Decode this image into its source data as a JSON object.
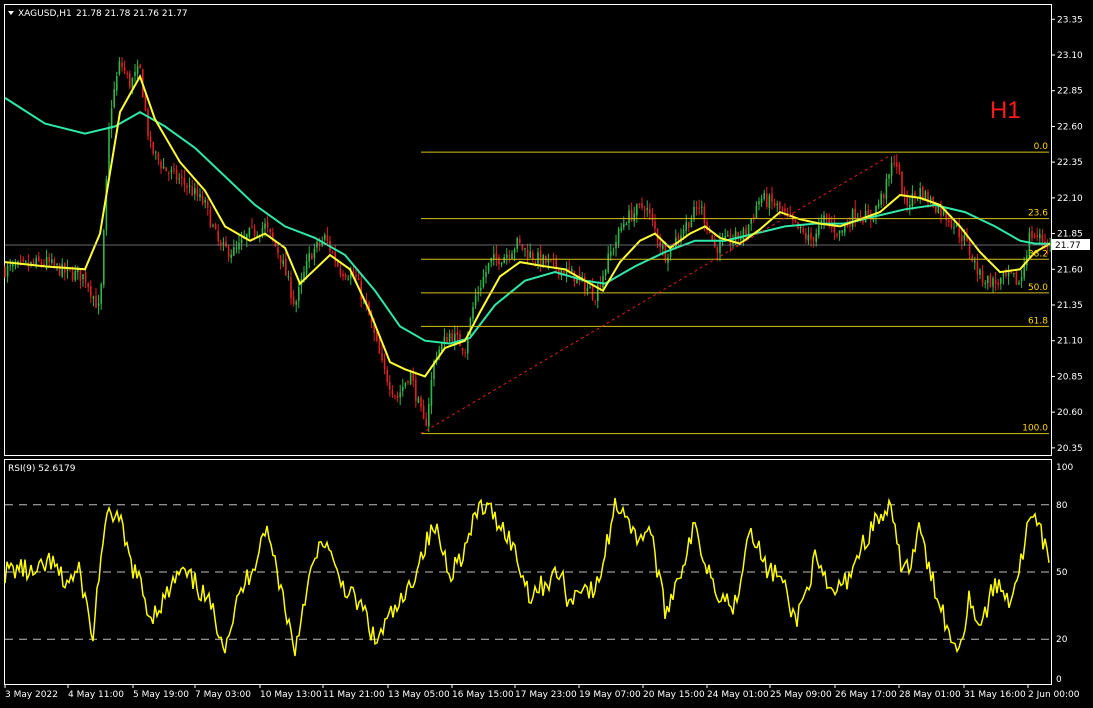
{
  "header": {
    "symbol_label": "XAGUSD,H1",
    "ohlc": "21.78 21.78 21.76 21.77",
    "timeframe_badge": "H1"
  },
  "rsi_panel": {
    "label": "RSI(9) 52.6179",
    "levels": [
      80,
      50,
      20
    ],
    "axis_top": "100",
    "axis_bottom": "0"
  },
  "colors": {
    "background": "#000000",
    "bull_candle": "#2fb84a",
    "bear_candle": "#e02020",
    "ma_fast": "#ffff33",
    "ma_slow": "#2ee8a8",
    "fib": "#d4c21a",
    "trendline": "#d92020",
    "rsi": "#ffff00",
    "axis_text": "#ffffff"
  },
  "chart_data": {
    "type": "candlestick",
    "symbol": "XAGUSD",
    "timeframe": "H1",
    "current_price": "21.77",
    "price_axis_ticks": [
      "23.35",
      "23.10",
      "22.85",
      "22.60",
      "22.35",
      "22.10",
      "21.85",
      "21.60",
      "21.35",
      "21.10",
      "20.85",
      "20.60",
      "20.35"
    ],
    "ylim": [
      20.3,
      23.45
    ],
    "time_axis_labels": [
      "3 May 2022",
      "4 May 11:00",
      "5 May 19:00",
      "7 May 03:00",
      "10 May 13:00",
      "11 May 21:00",
      "13 May 05:00",
      "16 May 15:00",
      "17 May 23:00",
      "19 May 07:00",
      "20 May 15:00",
      "24 May 01:00",
      "25 May 09:00",
      "26 May 17:00",
      "28 May 01:00",
      "31 May 16:00",
      "2 Jun 00:00"
    ],
    "close_path": [
      [
        0,
        21.6
      ],
      [
        20,
        21.62
      ],
      [
        40,
        21.65
      ],
      [
        60,
        21.58
      ],
      [
        80,
        21.55
      ],
      [
        95,
        21.3
      ],
      [
        105,
        22.7
      ],
      [
        115,
        23.05
      ],
      [
        125,
        22.9
      ],
      [
        135,
        23.0
      ],
      [
        145,
        22.45
      ],
      [
        160,
        22.3
      ],
      [
        180,
        22.2
      ],
      [
        200,
        22.05
      ],
      [
        215,
        21.75
      ],
      [
        230,
        21.72
      ],
      [
        245,
        21.85
      ],
      [
        260,
        21.9
      ],
      [
        275,
        21.7
      ],
      [
        290,
        21.35
      ],
      [
        305,
        21.7
      ],
      [
        320,
        21.82
      ],
      [
        335,
        21.6
      ],
      [
        350,
        21.55
      ],
      [
        365,
        21.25
      ],
      [
        378,
        20.9
      ],
      [
        392,
        20.7
      ],
      [
        405,
        20.88
      ],
      [
        420,
        20.48
      ],
      [
        430,
        21.0
      ],
      [
        445,
        21.15
      ],
      [
        460,
        21.05
      ],
      [
        470,
        21.4
      ],
      [
        485,
        21.65
      ],
      [
        500,
        21.7
      ],
      [
        512,
        21.78
      ],
      [
        530,
        21.68
      ],
      [
        550,
        21.62
      ],
      [
        570,
        21.55
      ],
      [
        590,
        21.42
      ],
      [
        605,
        21.7
      ],
      [
        620,
        21.95
      ],
      [
        640,
        22.05
      ],
      [
        660,
        21.7
      ],
      [
        680,
        21.9
      ],
      [
        695,
        22.05
      ],
      [
        710,
        21.75
      ],
      [
        725,
        21.8
      ],
      [
        740,
        21.85
      ],
      [
        755,
        22.1
      ],
      [
        770,
        22.05
      ],
      [
        790,
        21.9
      ],
      [
        805,
        21.8
      ],
      [
        820,
        21.95
      ],
      [
        835,
        21.85
      ],
      [
        850,
        22.0
      ],
      [
        865,
        21.95
      ],
      [
        880,
        22.15
      ],
      [
        890,
        22.4
      ],
      [
        900,
        22.05
      ],
      [
        915,
        22.15
      ],
      [
        930,
        22.05
      ],
      [
        945,
        21.95
      ],
      [
        960,
        21.8
      ],
      [
        975,
        21.55
      ],
      [
        990,
        21.5
      ],
      [
        1005,
        21.55
      ],
      [
        1015,
        21.5
      ],
      [
        1025,
        21.85
      ],
      [
        1040,
        21.8
      ],
      [
        1045,
        21.77
      ]
    ],
    "ma_fast_path": [
      [
        0,
        21.65
      ],
      [
        40,
        21.62
      ],
      [
        80,
        21.6
      ],
      [
        95,
        21.85
      ],
      [
        115,
        22.7
      ],
      [
        135,
        22.95
      ],
      [
        150,
        22.65
      ],
      [
        175,
        22.35
      ],
      [
        200,
        22.15
      ],
      [
        220,
        21.9
      ],
      [
        245,
        21.8
      ],
      [
        260,
        21.85
      ],
      [
        280,
        21.75
      ],
      [
        295,
        21.5
      ],
      [
        310,
        21.6
      ],
      [
        325,
        21.7
      ],
      [
        345,
        21.6
      ],
      [
        365,
        21.3
      ],
      [
        385,
        20.95
      ],
      [
        400,
        20.9
      ],
      [
        420,
        20.85
      ],
      [
        440,
        21.05
      ],
      [
        460,
        21.1
      ],
      [
        475,
        21.3
      ],
      [
        495,
        21.55
      ],
      [
        515,
        21.65
      ],
      [
        540,
        21.62
      ],
      [
        560,
        21.6
      ],
      [
        580,
        21.52
      ],
      [
        598,
        21.45
      ],
      [
        615,
        21.65
      ],
      [
        635,
        21.8
      ],
      [
        650,
        21.85
      ],
      [
        665,
        21.75
      ],
      [
        685,
        21.85
      ],
      [
        700,
        21.9
      ],
      [
        715,
        21.82
      ],
      [
        735,
        21.78
      ],
      [
        755,
        21.88
      ],
      [
        775,
        22.0
      ],
      [
        795,
        21.95
      ],
      [
        815,
        21.92
      ],
      [
        835,
        21.9
      ],
      [
        855,
        21.95
      ],
      [
        875,
        22.0
      ],
      [
        895,
        22.12
      ],
      [
        915,
        22.1
      ],
      [
        935,
        22.05
      ],
      [
        955,
        21.9
      ],
      [
        975,
        21.72
      ],
      [
        995,
        21.58
      ],
      [
        1015,
        21.6
      ],
      [
        1030,
        21.72
      ],
      [
        1045,
        21.78
      ]
    ],
    "ma_slow_path": [
      [
        0,
        22.8
      ],
      [
        40,
        22.62
      ],
      [
        80,
        22.55
      ],
      [
        110,
        22.6
      ],
      [
        135,
        22.7
      ],
      [
        160,
        22.6
      ],
      [
        190,
        22.45
      ],
      [
        220,
        22.25
      ],
      [
        250,
        22.05
      ],
      [
        280,
        21.9
      ],
      [
        310,
        21.82
      ],
      [
        340,
        21.7
      ],
      [
        370,
        21.45
      ],
      [
        395,
        21.2
      ],
      [
        420,
        21.1
      ],
      [
        445,
        21.08
      ],
      [
        465,
        21.12
      ],
      [
        490,
        21.35
      ],
      [
        520,
        21.52
      ],
      [
        550,
        21.58
      ],
      [
        580,
        21.52
      ],
      [
        600,
        21.5
      ],
      [
        630,
        21.62
      ],
      [
        660,
        21.72
      ],
      [
        690,
        21.8
      ],
      [
        720,
        21.8
      ],
      [
        750,
        21.85
      ],
      [
        780,
        21.9
      ],
      [
        810,
        21.92
      ],
      [
        840,
        21.92
      ],
      [
        870,
        21.97
      ],
      [
        900,
        22.02
      ],
      [
        930,
        22.05
      ],
      [
        960,
        22.0
      ],
      [
        990,
        21.9
      ],
      [
        1015,
        21.8
      ],
      [
        1030,
        21.78
      ],
      [
        1045,
        21.78
      ]
    ],
    "fibonacci": {
      "high": 22.42,
      "low": 20.45,
      "levels": [
        {
          "label": "0.0",
          "price": 22.42
        },
        {
          "label": "23.6",
          "price": 21.955
        },
        {
          "label": "38.2",
          "price": 21.67
        },
        {
          "label": "50.0",
          "price": 21.435
        },
        {
          "label": "61.8",
          "price": 21.2
        },
        {
          "label": "100.0",
          "price": 20.45
        }
      ]
    },
    "trendline": {
      "from_price": 20.45,
      "to_price": 22.4
    },
    "rsi": {
      "period": 9,
      "ylim": [
        0,
        100
      ],
      "levels": [
        80,
        50,
        20
      ],
      "path": [
        [
          0,
          50
        ],
        [
          15,
          52
        ],
        [
          30,
          48
        ],
        [
          45,
          55
        ],
        [
          60,
          45
        ],
        [
          75,
          50
        ],
        [
          88,
          20
        ],
        [
          95,
          55
        ],
        [
          105,
          78
        ],
        [
          115,
          72
        ],
        [
          125,
          55
        ],
        [
          135,
          45
        ],
        [
          145,
          30
        ],
        [
          160,
          38
        ],
        [
          175,
          50
        ],
        [
          190,
          45
        ],
        [
          205,
          35
        ],
        [
          220,
          18
        ],
        [
          235,
          40
        ],
        [
          250,
          55
        ],
        [
          260,
          70
        ],
        [
          270,
          55
        ],
        [
          280,
          35
        ],
        [
          290,
          15
        ],
        [
          300,
          40
        ],
        [
          310,
          55
        ],
        [
          320,
          65
        ],
        [
          330,
          50
        ],
        [
          345,
          40
        ],
        [
          360,
          32
        ],
        [
          370,
          18
        ],
        [
          385,
          30
        ],
        [
          400,
          38
        ],
        [
          410,
          50
        ],
        [
          420,
          62
        ],
        [
          430,
          70
        ],
        [
          445,
          50
        ],
        [
          460,
          60
        ],
        [
          475,
          80
        ],
        [
          490,
          75
        ],
        [
          505,
          65
        ],
        [
          515,
          52
        ],
        [
          525,
          40
        ],
        [
          540,
          45
        ],
        [
          555,
          50
        ],
        [
          565,
          35
        ],
        [
          575,
          45
        ],
        [
          590,
          40
        ],
        [
          600,
          58
        ],
        [
          610,
          80
        ],
        [
          620,
          78
        ],
        [
          630,
          65
        ],
        [
          645,
          70
        ],
        [
          660,
          32
        ],
        [
          675,
          50
        ],
        [
          690,
          70
        ],
        [
          700,
          55
        ],
        [
          715,
          40
        ],
        [
          730,
          35
        ],
        [
          745,
          72
        ],
        [
          760,
          52
        ],
        [
          775,
          48
        ],
        [
          790,
          28
        ],
        [
          800,
          40
        ],
        [
          810,
          55
        ],
        [
          825,
          40
        ],
        [
          840,
          45
        ],
        [
          855,
          60
        ],
        [
          870,
          72
        ],
        [
          885,
          78
        ],
        [
          895,
          55
        ],
        [
          905,
          52
        ],
        [
          915,
          70
        ],
        [
          925,
          48
        ],
        [
          935,
          38
        ],
        [
          945,
          20
        ],
        [
          955,
          18
        ],
        [
          965,
          40
        ],
        [
          975,
          25
        ],
        [
          990,
          45
        ],
        [
          1005,
          38
        ],
        [
          1015,
          52
        ],
        [
          1025,
          75
        ],
        [
          1035,
          68
        ],
        [
          1045,
          52
        ]
      ]
    }
  }
}
